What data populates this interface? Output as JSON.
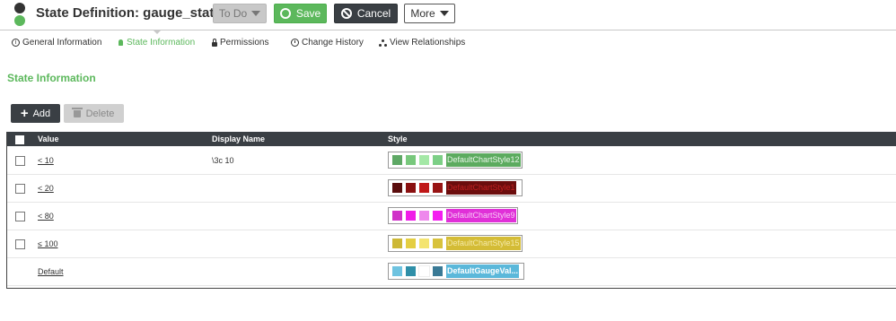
{
  "header": {
    "title": "State Definition: gauge_state",
    "help_glyph": "?",
    "todo_label": "To Do",
    "save_label": "Save",
    "cancel_label": "Cancel",
    "more_label": "More"
  },
  "tabs": [
    {
      "label": "General Information",
      "icon": "info-icon"
    },
    {
      "label": "State Information",
      "icon": "bulb-icon"
    },
    {
      "label": "Permissions",
      "icon": "lock-icon"
    },
    {
      "label": "Change History",
      "icon": "clock-icon"
    },
    {
      "label": "View Relationships",
      "icon": "relationships-icon"
    }
  ],
  "section_title": "State Information",
  "toolbar": {
    "add_label": "Add",
    "delete_label": "Delete"
  },
  "table": {
    "columns": [
      "Value",
      "Display Name",
      "Style"
    ],
    "rows": [
      {
        "value": "< 10",
        "display_name": "\\3c 10",
        "swatches": [
          "#5ea865",
          "#78c87c",
          "#a4e8a6",
          "#7ccf86"
        ],
        "style_name": "DefaultChartStyle12",
        "label_bg": "#5cab5f",
        "label_fg": "#e8f5e8",
        "checkbox": true
      },
      {
        "value": "< 20",
        "display_name": "",
        "swatches": [
          "#5a0c0c",
          "#8a1010",
          "#c01818",
          "#981414"
        ],
        "style_name": "DefaultChartStyle1",
        "label_bg": "#6b0d0d",
        "label_fg": "#c02020",
        "checkbox": true
      },
      {
        "value": "< 80",
        "display_name": "",
        "swatches": [
          "#d030c8",
          "#f01ce8",
          "#ee88ec",
          "#f41cf0"
        ],
        "style_name": "DefaultChartStyle9",
        "label_bg": "#e030d8",
        "label_fg": "#f7c8f5",
        "checkbox": true
      },
      {
        "value": "≤ 100",
        "display_name": "",
        "swatches": [
          "#cdb835",
          "#e4ce42",
          "#f4e470",
          "#d8c23c"
        ],
        "style_name": "DefaultChartStyle15",
        "label_bg": "#d4bc36",
        "label_fg": "#f5eaa8",
        "checkbox": true
      },
      {
        "value": "Default",
        "display_name": "",
        "swatches": [
          "#6ec3e0",
          "#2f8fa8",
          "#ffffff",
          "#3a7a96"
        ],
        "style_name": "DefaultGaugeVal...",
        "label_bg": "#5bb8da",
        "label_fg": "#ffffff",
        "checkbox": false
      }
    ]
  }
}
